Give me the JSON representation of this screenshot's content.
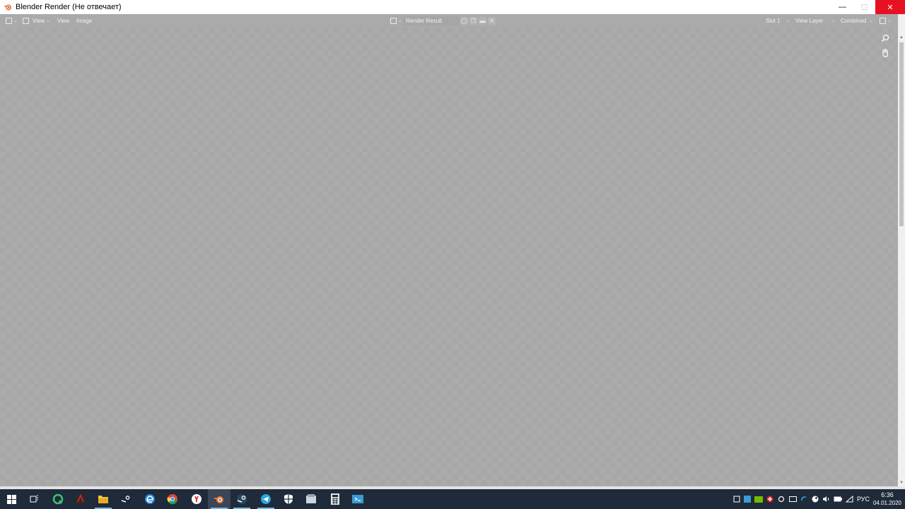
{
  "window": {
    "title": "Blender Render (Не отвечает)",
    "minimize_glyph": "—",
    "maximize_glyph": "☐",
    "close_glyph": "✕"
  },
  "header": {
    "menu_view_dropdown": "View",
    "menu_view": "View",
    "menu_image": "Image",
    "image_name": "Render Result",
    "slot": "Slot 1",
    "view_layer": "View Layer",
    "pass": "Combined"
  },
  "taskbar": {
    "apps": [
      "start",
      "task-view",
      "qbittorrent",
      "razer",
      "explorer",
      "steam",
      "edge",
      "chrome",
      "yandex",
      "blender",
      "steam-2",
      "telegram",
      "defender",
      "notes",
      "calculator",
      "screen"
    ],
    "language": "РУС",
    "time": "6:36",
    "date": "04.01.2020"
  },
  "colors": {
    "accent_red": "#e81123",
    "taskbar_bg": "#1f2a3a",
    "blender_orange": "#f5792a"
  }
}
